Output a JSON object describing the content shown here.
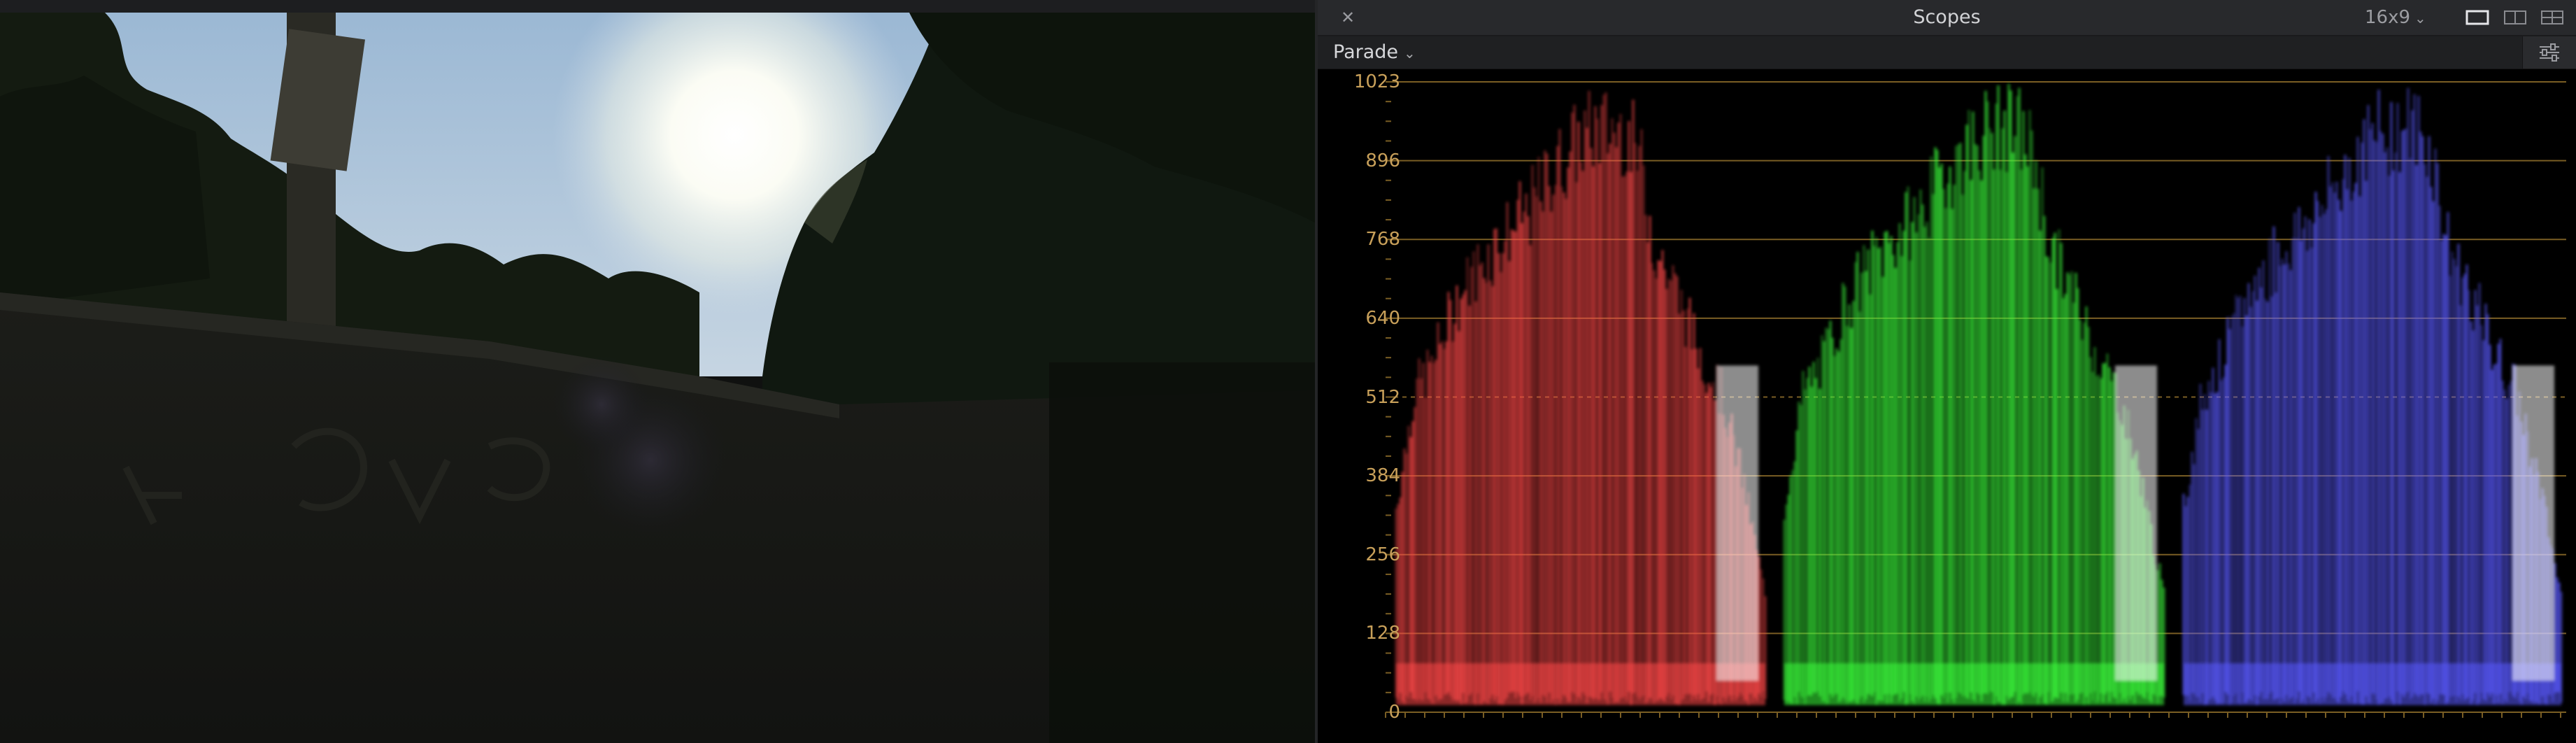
{
  "viewer": {
    "description_icon": "image-preview",
    "colors": {
      "sky": "#a9c3d8",
      "sun": "#f6f8ee",
      "foliage": "#131a10",
      "wall": "#161714"
    }
  },
  "scopes_panel": {
    "close_icon": "close-icon",
    "title": "Scopes",
    "aspect": "16x9",
    "layout_buttons": [
      "single-layout-icon",
      "dual-layout-icon",
      "quad-layout-icon"
    ],
    "scope_type": "Parade",
    "settings_icon": "sliders-icon",
    "y_axis_labels": [
      "1023",
      "896",
      "768",
      "640",
      "512",
      "384",
      "256",
      "128",
      "0"
    ],
    "colors": {
      "label": "#c8a05a",
      "graticule": "#7a5e24",
      "red": "#ff4848",
      "green": "#3cff3c",
      "blue": "#5a5aff"
    }
  }
}
